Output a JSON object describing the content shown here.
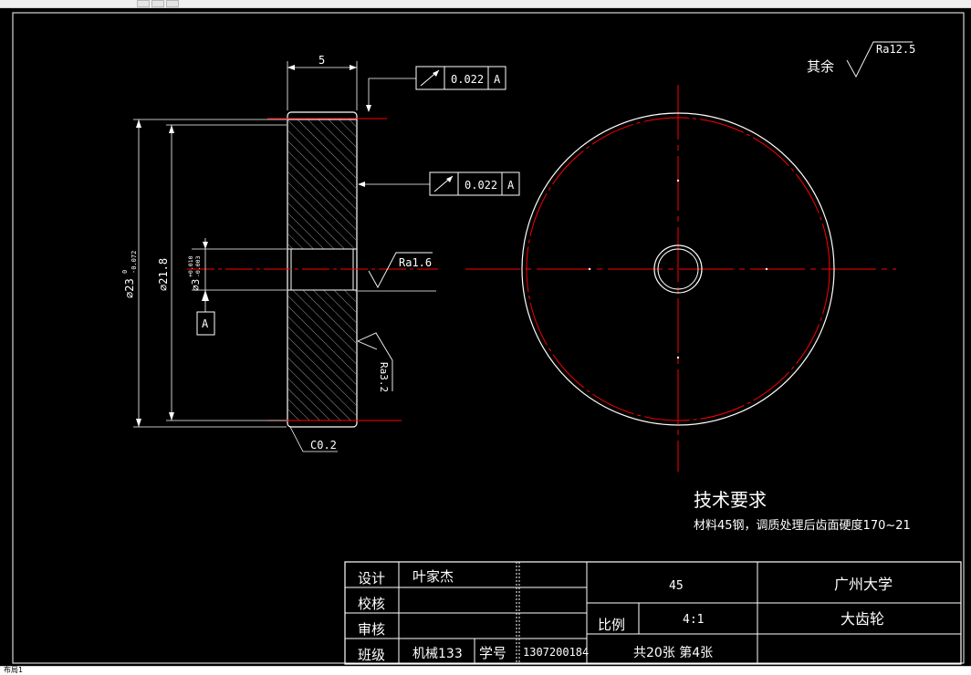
{
  "drawing": {
    "dims": {
      "width_top": "5",
      "dia_outer": "⌀23",
      "dia_outer_tol": "0",
      "dia_outer_tol_lower": "-0.072",
      "dia_mid": "⌀21.8",
      "dia_bore": "⌀3",
      "dia_bore_tol_upper": "+0.010",
      "dia_bore_tol_lower": "-0.003",
      "datum_label": "A",
      "chamfer": "C0.2"
    },
    "tolerance_frames": [
      {
        "value": "0.022",
        "datum": "A"
      },
      {
        "value": "0.022",
        "datum": "A"
      }
    ],
    "roughness": {
      "rest_label": "其余",
      "rest_value": "Ra12.5",
      "bore_value": "Ra1.6",
      "face_value": "Ra3.2"
    },
    "tech": {
      "title": "技术要求",
      "note": "材料45钢，调质处理后齿面硬度170~21"
    },
    "title_block": {
      "design_label": "设计",
      "designer": "叶家杰",
      "check_label": "校核",
      "review_label": "审核",
      "class_label": "班级",
      "class_value": "机械133",
      "student_no_label": "学号",
      "student_no": "1307200184",
      "material": "45",
      "scale_label": "比例",
      "scale_value": "4:1",
      "sheets": "共20张 第4张",
      "school": "广州大学",
      "part_name": "大齿轮"
    }
  },
  "colors": {
    "background": "#000000",
    "line": "#ffffff",
    "center_line": "#ff0000"
  },
  "status": {
    "text": "布局1"
  }
}
